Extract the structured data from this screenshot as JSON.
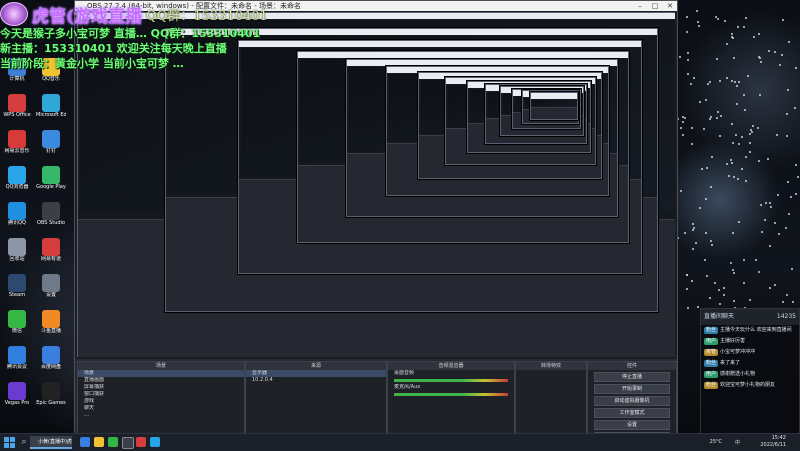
{
  "overlay": {
    "brand": "虎管(游戏直播",
    "qq_label": "QQ群：153310401",
    "lines": [
      "今天是猴子多小宝可梦 直播…  QQ群：153310401",
      "新主播：153310401 欢迎关注每天晚上直播",
      "当前阶段：黄金小学 当前小宝可梦 …"
    ]
  },
  "desktop_icons": [
    {
      "label": "计算机",
      "icon": "computer-icon",
      "color": "#3d7fd6"
    },
    {
      "label": "QQ音乐",
      "icon": "music-icon",
      "color": "#f0c431"
    },
    {
      "label": "WPS Office",
      "icon": "wps-icon",
      "color": "#d63d3d"
    },
    {
      "label": "Microsoft Edge",
      "icon": "edge-icon",
      "color": "#2fa7d8"
    },
    {
      "label": "网易云音乐",
      "icon": "netease-icon",
      "color": "#d83a3a"
    },
    {
      "label": "钉钉",
      "icon": "dingtalk-icon",
      "color": "#3a8be0"
    },
    {
      "label": "QQ浏览器",
      "icon": "browser-icon",
      "color": "#2aa4e8"
    },
    {
      "label": "Google Play",
      "icon": "play-icon",
      "color": "#35b86a"
    },
    {
      "label": "腾讯QQ",
      "icon": "qq-icon",
      "color": "#1f8fe0"
    },
    {
      "label": "OBS Studio",
      "icon": "obs-icon",
      "color": "#3b3f48"
    },
    {
      "label": "回收站",
      "icon": "trash-icon",
      "color": "#8c96a6"
    },
    {
      "label": "网易有道",
      "icon": "youdao-icon",
      "color": "#d63d3d"
    },
    {
      "label": "Steam",
      "icon": "steam-icon",
      "color": "#2b4a6e"
    },
    {
      "label": "设置",
      "icon": "settings-icon",
      "color": "#6e7a8a"
    },
    {
      "label": "微信",
      "icon": "wechat-icon",
      "color": "#35b843"
    },
    {
      "label": "斗鱼直播",
      "icon": "douyu-icon",
      "color": "#f08a24"
    },
    {
      "label": "腾讯会议",
      "icon": "meeting-icon",
      "color": "#2f7ee0"
    },
    {
      "label": "百度网盘",
      "icon": "baidu-icon",
      "color": "#3a7fe0"
    },
    {
      "label": "Vegas Pro",
      "icon": "vegas-icon",
      "color": "#6a3bd0"
    },
    {
      "label": "Epic Games",
      "icon": "epic-icon",
      "color": "#222"
    }
  ],
  "obs": {
    "title": "OBS 27.2.4 (64-bit, windows) - 配置文件：未命名 - 场景：未命名",
    "docks": {
      "scenes_header": "场景",
      "scenes": [
        "场景",
        "直播画面",
        "屏幕捕获",
        "窗口捕获",
        "游戏",
        "聊天",
        "…"
      ],
      "sources_header": "来源",
      "sources": [
        "显示器",
        "10.2.0.4"
      ],
      "mixer_header": "音频混音器",
      "mixer": [
        "桌面音频",
        "麦克风/Aux"
      ],
      "transitions_header": "转场特效",
      "controls_header": "控件",
      "controls": [
        "停止直播",
        "开始录制",
        "启动虚拟摄像机",
        "工作室模式",
        "设置",
        "退出"
      ]
    }
  },
  "chat": {
    "header": "直播间聊天",
    "count": "14235",
    "messages": [
      {
        "badge": "粉丝",
        "text": "主播今天玩什么 欢迎来到直播间"
      },
      {
        "badge": "用户",
        "text": "主播好厉害"
      },
      {
        "badge": "房管",
        "text": "小宝可梦冲冲冲"
      },
      {
        "badge": "粉丝",
        "text": "来了来了"
      },
      {
        "badge": "用户",
        "text": "感谢赠送小礼物"
      },
      {
        "badge": "粉丝",
        "text": "欢迎宝可梦小礼物的朋友"
      }
    ]
  },
  "taskbar": {
    "active_task": "小黄(直播中)虎管",
    "time": "15:42",
    "date": "2022/6/11",
    "lang": "中",
    "temp": "25°C"
  },
  "colors": {
    "overlay_purple": "#c56bff",
    "overlay_green": "#6dff7a",
    "obs_bg": "#1a1d22",
    "accent": "#3b4a69"
  }
}
